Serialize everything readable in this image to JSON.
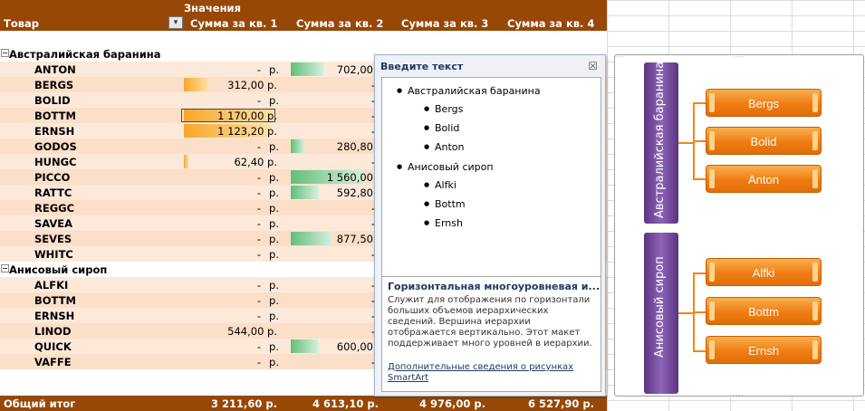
{
  "pivot": {
    "values_header": "Значения",
    "row_header": "Товар",
    "col_headers": [
      "Сумма за кв. 1",
      "Сумма за кв. 2",
      "Сумма за кв. 3",
      "Сумма за кв. 4"
    ],
    "groups": [
      {
        "name": "Австралийская баранина",
        "items": [
          {
            "name": "ANTON",
            "q1": "-",
            "q1_unit": "р.",
            "q2": "702,00",
            "q2_bar": 0.45
          },
          {
            "name": "BERGS",
            "q1": "312,00 р.",
            "q1_bar": 0.27,
            "q2": "-"
          },
          {
            "name": "BOLID",
            "q1": "-",
            "q1_unit": "р.",
            "q2": "-"
          },
          {
            "name": "BOTTM",
            "q1": "1 170,00 р.",
            "q1_bar": 1.0,
            "q1_boxed": true,
            "q2": "-"
          },
          {
            "name": "ERNSH",
            "q1": "1 123,20 р.",
            "q1_bar": 0.96,
            "q2": "-"
          },
          {
            "name": "GODOS",
            "q1": "-",
            "q1_unit": "р.",
            "q2": "280,80",
            "q2_bar": 0.18
          },
          {
            "name": "HUNGC",
            "q1": "62,40 р.",
            "q1_bar": 0.05,
            "q2": "-"
          },
          {
            "name": "PICCO",
            "q1": "-",
            "q1_unit": "р.",
            "q2": "1 560,00",
            "q2_bar": 1.0
          },
          {
            "name": "RATTC",
            "q1": "-",
            "q1_unit": "р.",
            "q2": "592,80",
            "q2_bar": 0.38
          },
          {
            "name": "REGGC",
            "q1": "-",
            "q1_unit": "р.",
            "q2": "-"
          },
          {
            "name": "SAVEA",
            "q1": "-",
            "q1_unit": "р.",
            "q2": "-"
          },
          {
            "name": "SEVES",
            "q1": "-",
            "q1_unit": "р.",
            "q2": "877,50",
            "q2_bar": 0.56
          },
          {
            "name": "WHITC",
            "q1": "-",
            "q1_unit": "р.",
            "q2": "-"
          }
        ]
      },
      {
        "name": "Анисовый сироп",
        "items": [
          {
            "name": "ALFKI",
            "q1": "-",
            "q1_unit": "р.",
            "q2": "-"
          },
          {
            "name": "BOTTM",
            "q1": "-",
            "q1_unit": "р.",
            "q2": "-"
          },
          {
            "name": "ERNSH",
            "q1": "-",
            "q1_unit": "р.",
            "q2": "-"
          },
          {
            "name": "LINOD",
            "q1": "544,00 р.",
            "q2": "-"
          },
          {
            "name": "QUICK",
            "q1": "-",
            "q1_unit": "р.",
            "q2": "600,00",
            "q2_bar": 0.38
          },
          {
            "name": "VAFFE",
            "q1": "-",
            "q1_unit": "р.",
            "q2": "-"
          }
        ]
      }
    ],
    "total": {
      "name": "Общий итог",
      "q1": "3 211,60 р.",
      "q2": "4 613,10 р.",
      "q3": "4 976,00 р.",
      "q4": "6 527,90 р."
    }
  },
  "text_pane": {
    "title": "Введите текст",
    "close_glyph": "☒",
    "items": [
      {
        "level": 1,
        "text": "Австралийская баранина"
      },
      {
        "level": 2,
        "text": "Bergs"
      },
      {
        "level": 2,
        "text": "Bolid"
      },
      {
        "level": 2,
        "text": "Anton"
      },
      {
        "level": 1,
        "text": "Анисовый сироп"
      },
      {
        "level": 2,
        "text": "Alfki"
      },
      {
        "level": 2,
        "text": "Bottm"
      },
      {
        "level": 2,
        "text": "Ernsh"
      }
    ],
    "desc_title": "Горизонтальная многоуровневая и...",
    "desc_text": "Служит для отображения по горизонтали больших объемов иерархических сведений. Вершина иерархии отображается вертикально. Этот макет поддерживает много уровней в иерархии.",
    "link": "Дополнительные сведения о рисунках SmartArt"
  },
  "smartart": {
    "groups": [
      {
        "label": "Австралийская баранина",
        "children": [
          "Bergs",
          "Bolid",
          "Anton"
        ]
      },
      {
        "label": "Анисовый сироп",
        "children": [
          "Alfki",
          "Bottm",
          "Ernsh"
        ]
      }
    ]
  },
  "colors": {
    "header_bg": "#974706",
    "row_bg": "#fde9d9",
    "bar_orange": "#f8a72a",
    "bar_green": "#63be7b",
    "smartart_purple": "#7a4fa3",
    "smartart_orange": "#f07c14"
  }
}
